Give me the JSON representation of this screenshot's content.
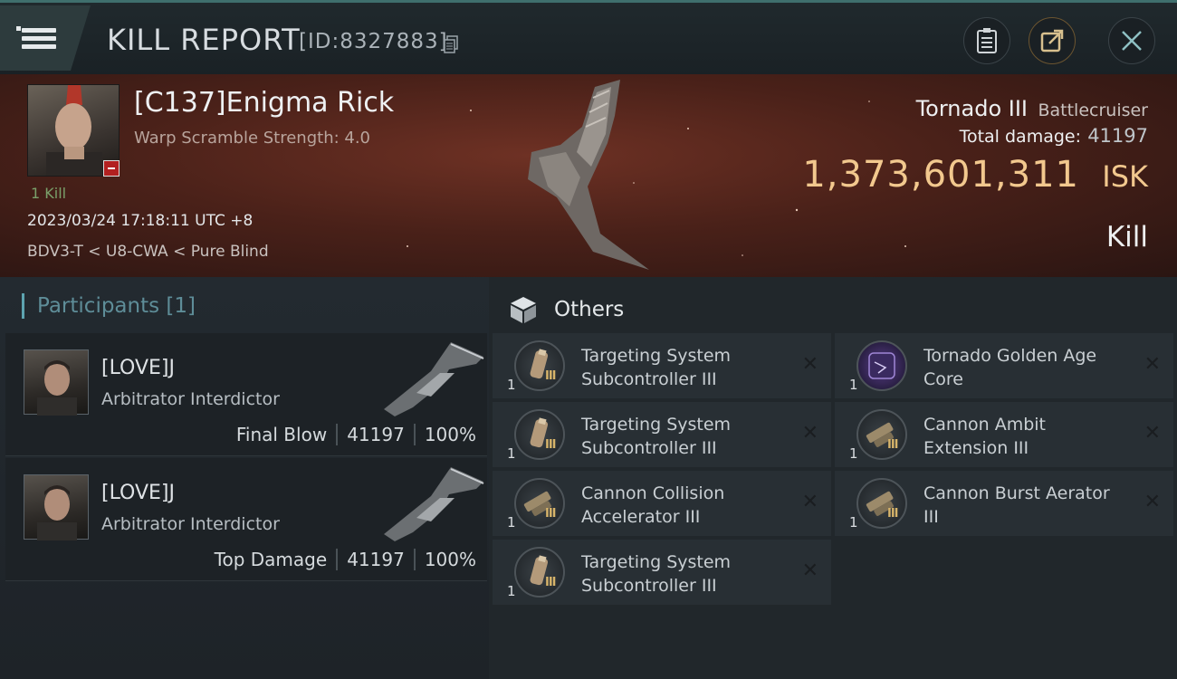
{
  "header": {
    "title": "KILL REPORT",
    "report_id": "[ID:8327883]"
  },
  "victim": {
    "name": "[C137]Enigma Rick",
    "scramble": "Warp Scramble Strength: 4.0",
    "kill_count": "1 Kill",
    "timestamp": "2023/03/24 17:18:11 UTC +8",
    "location": "BDV3-T < U8-CWA < Pure Blind",
    "ship_name": "Tornado III",
    "ship_class": "Battlecruiser",
    "total_damage_label": "Total damage:",
    "total_damage": "41197",
    "isk_value": "1,373,601,311",
    "isk_unit": "ISK",
    "result": "Kill"
  },
  "participants": {
    "title": "Participants [1]",
    "items": [
      {
        "name": "[LOVE]J",
        "ship": "Arbitrator Interdictor",
        "role": "Final Blow",
        "damage": "41197",
        "percent": "100%"
      },
      {
        "name": "[LOVE]J",
        "ship": "Arbitrator Interdictor",
        "role": "Top Damage",
        "damage": "41197",
        "percent": "100%"
      }
    ]
  },
  "others": {
    "title": "Others",
    "items": [
      {
        "name": "Targeting System Subcontroller III",
        "qty": "1",
        "tier": "III",
        "icon": "tube-icon"
      },
      {
        "name": "Tornado Golden Age Core",
        "qty": "1",
        "tier": "",
        "icon": "core-icon"
      },
      {
        "name": "Targeting System Subcontroller III",
        "qty": "1",
        "tier": "III",
        "icon": "tube-icon"
      },
      {
        "name": "Cannon Ambit Extension III",
        "qty": "1",
        "tier": "III",
        "icon": "cannon-icon"
      },
      {
        "name": "Cannon Collision Accelerator III",
        "qty": "1",
        "tier": "III",
        "icon": "cannon-icon"
      },
      {
        "name": "Cannon Burst Aerator III",
        "qty": "1",
        "tier": "III",
        "icon": "cannon-icon"
      },
      {
        "name": "Targeting System Subcontroller III",
        "qty": "1",
        "tier": "III",
        "icon": "tube-icon"
      }
    ]
  },
  "colors": {
    "accent_teal": "#5da4b0",
    "isk_gold": "#f2c88e",
    "banner_red": "#4a2119"
  }
}
